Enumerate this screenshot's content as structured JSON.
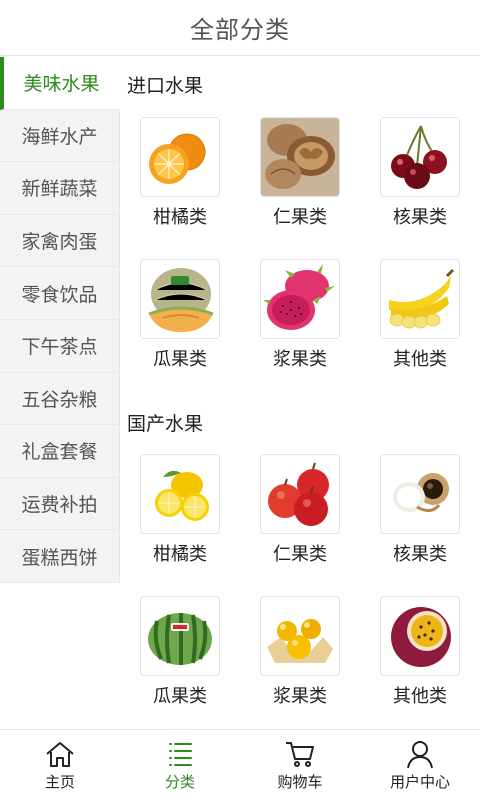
{
  "header": {
    "title": "全部分类"
  },
  "sidebar": {
    "items": [
      {
        "label": "美味水果",
        "active": true
      },
      {
        "label": "海鲜水产",
        "active": false
      },
      {
        "label": "新鲜蔬菜",
        "active": false
      },
      {
        "label": "家禽肉蛋",
        "active": false
      },
      {
        "label": "零食饮品",
        "active": false
      },
      {
        "label": "下午茶点",
        "active": false
      },
      {
        "label": "五谷杂粮",
        "active": false
      },
      {
        "label": "礼盒套餐",
        "active": false
      },
      {
        "label": "运费补拍",
        "active": false
      },
      {
        "label": "蛋糕西饼",
        "active": false
      }
    ]
  },
  "sections": [
    {
      "title": "进口水果",
      "items": [
        {
          "label": "柑橘类",
          "icon": "orange-fruit-icon"
        },
        {
          "label": "仁果类",
          "icon": "walnut-icon"
        },
        {
          "label": "核果类",
          "icon": "cherry-icon"
        },
        {
          "label": "瓜果类",
          "icon": "melon-icon"
        },
        {
          "label": "浆果类",
          "icon": "dragon-fruit-icon"
        },
        {
          "label": "其他类",
          "icon": "banana-icon"
        }
      ]
    },
    {
      "title": "国产水果",
      "items": [
        {
          "label": "柑橘类",
          "icon": "lemon-icon"
        },
        {
          "label": "仁果类",
          "icon": "apple-icon"
        },
        {
          "label": "核果类",
          "icon": "longan-icon"
        },
        {
          "label": "瓜果类",
          "icon": "watermelon-icon"
        },
        {
          "label": "浆果类",
          "icon": "golden-berry-icon"
        },
        {
          "label": "其他类",
          "icon": "passion-fruit-icon"
        }
      ]
    }
  ],
  "tabbar": {
    "items": [
      {
        "label": "主页",
        "icon": "home-icon",
        "active": false
      },
      {
        "label": "分类",
        "icon": "list-icon",
        "active": true
      },
      {
        "label": "购物车",
        "icon": "cart-icon",
        "active": false
      },
      {
        "label": "用户中心",
        "icon": "user-icon",
        "active": false
      }
    ]
  },
  "colors": {
    "accent": "#2e8b1f",
    "sidebar_bg": "#f3f3f3",
    "divider": "#e5e5e5"
  }
}
